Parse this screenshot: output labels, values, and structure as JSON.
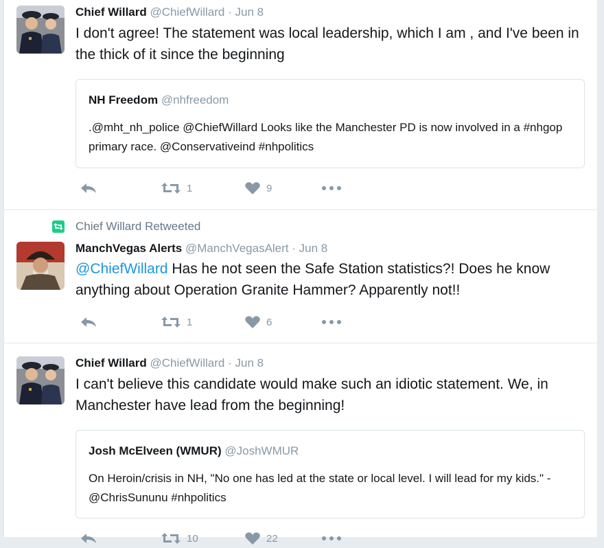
{
  "tweets": [
    {
      "author_name": "Chief Willard",
      "author_handle": "@ChiefWillard",
      "separator": "·",
      "date": "Jun 8",
      "text": "I don't agree! The statement was local leadership, which I am , and I've been in the thick of it since the beginning",
      "quote": {
        "author_name": "NH Freedom",
        "author_handle": "@nhfreedom",
        "text": ".@mht_nh_police @ChiefWillard Looks like the Manchester PD is now involved in a #nhgop primary race. @Conservativeind #nhpolitics"
      },
      "retweets": "1",
      "likes": "9"
    },
    {
      "retweeted_by": "Chief Willard Retweeted",
      "author_name": "ManchVegas Alerts",
      "author_handle": "@ManchVegasAlert",
      "separator": "·",
      "date": "Jun 8",
      "text_mention": "@ChiefWillard",
      "text_rest": " Has he not seen the Safe Station statistics?! Does he know anything about Operation Granite Hammer? Apparently not!!",
      "retweets": "1",
      "likes": "6"
    },
    {
      "author_name": "Chief Willard",
      "author_handle": "@ChiefWillard",
      "separator": "·",
      "date": "Jun 8",
      "text": "I can't believe this candidate would make such an idiotic statement. We, in Manchester have lead from the beginning!",
      "quote": {
        "author_name": "Josh McElveen (WMUR)",
        "author_handle": "@JoshWMUR",
        "text": "On Heroin/crisis in NH, \"No one has led at the state or local level. I will lead for my kids.\" - @ChrisSununu #nhpolitics"
      },
      "retweets": "10",
      "likes": "22"
    }
  ],
  "icons": {
    "reply": "reply-icon",
    "retweet": "retweet-icon",
    "like": "heart-icon",
    "more": "more-dots-icon"
  },
  "colors": {
    "link": "#1b95e0",
    "meta": "#8899a6",
    "retweet_badge": "#19cf86"
  }
}
